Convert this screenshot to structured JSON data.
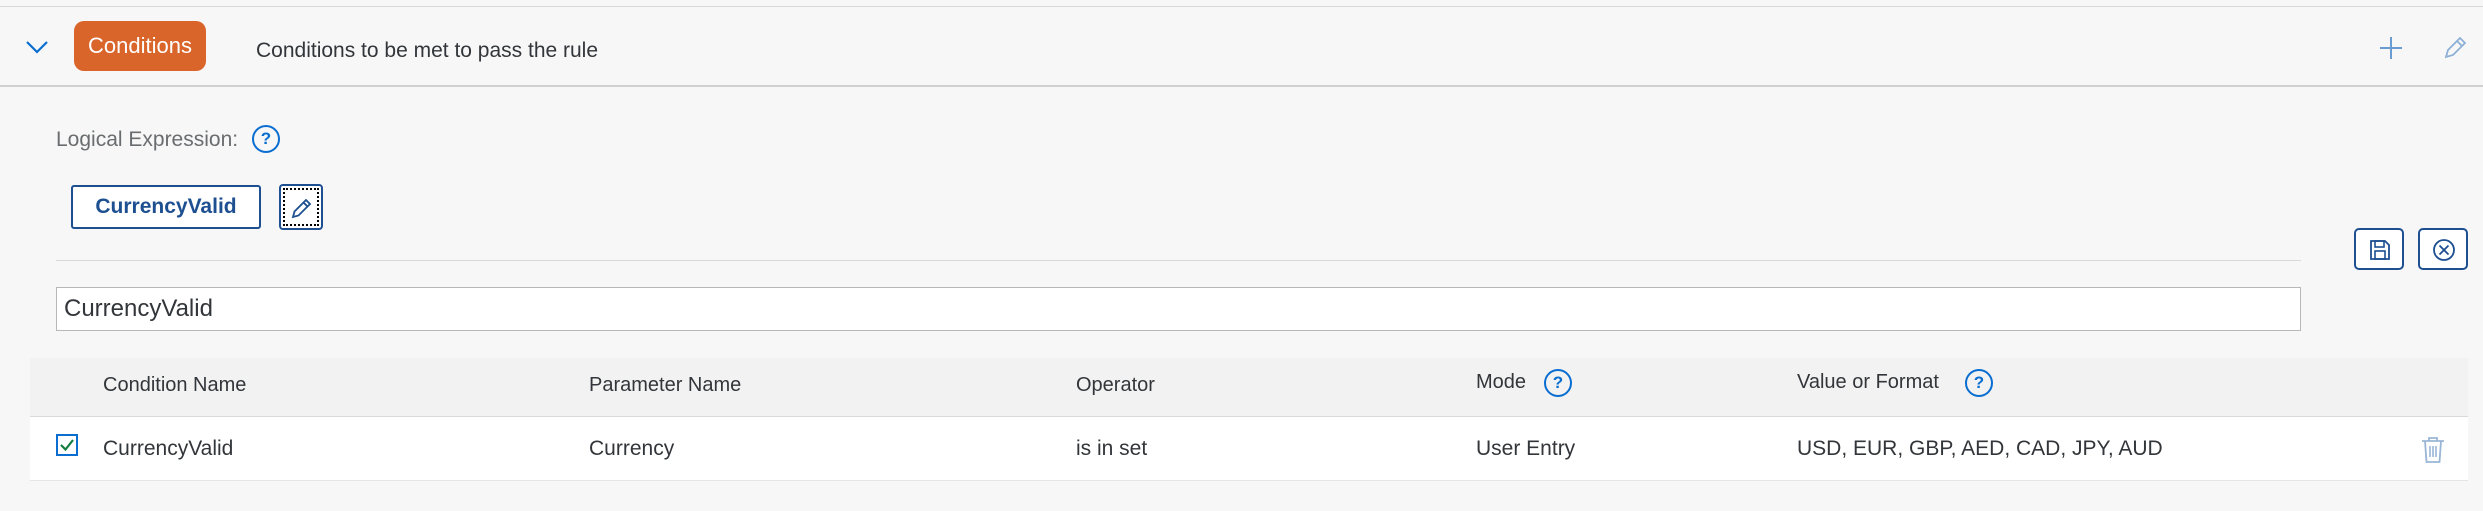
{
  "section": {
    "badge_label": "Conditions",
    "description": "Conditions to be met to pass the rule"
  },
  "logical_expression": {
    "label": "Logical Expression:",
    "help_symbol": "?",
    "token": "CurrencyValid",
    "input_value": "CurrencyValid"
  },
  "table": {
    "headers": {
      "condition_name": "Condition Name",
      "parameter_name": "Parameter Name",
      "operator": "Operator",
      "mode": "Mode",
      "value_or_format": "Value or Format"
    },
    "rows": [
      {
        "selected": true,
        "condition_name": "CurrencyValid",
        "parameter_name": "Currency",
        "operator": "is in set",
        "mode": "User Entry",
        "value_or_format": "USD, EUR, GBP, AED, CAD, JPY, AUD"
      }
    ]
  },
  "icons": {
    "collapse": "chevron-down-icon",
    "add": "plus-icon",
    "edit": "pencil-icon",
    "save": "save-icon",
    "cancel": "close-circle-icon",
    "delete": "trash-icon",
    "help": "help-icon",
    "check": "check-icon"
  },
  "colors": {
    "badge": "#d9652a",
    "accent": "#1d4f91",
    "link_blue": "#0a6ed1",
    "check_green": "#107e3e",
    "background": "#f7f7f7"
  }
}
